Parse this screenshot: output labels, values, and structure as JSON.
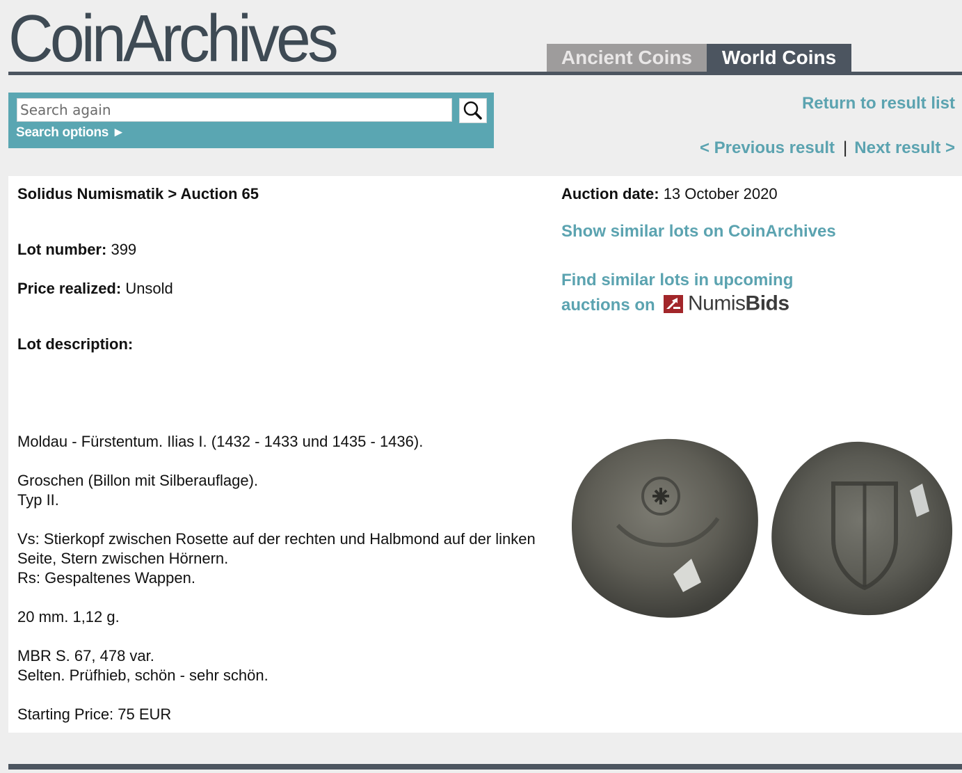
{
  "brand": {
    "logo_text": "CoinArchives"
  },
  "tabs": [
    {
      "label": "Ancient Coins"
    },
    {
      "label": "World Coins"
    }
  ],
  "search": {
    "placeholder": "Search again",
    "options_label": "Search options ►"
  },
  "navigation": {
    "return_label": "Return to result list",
    "previous_label": "< Previous result",
    "separator": "|",
    "next_label": "Next result >"
  },
  "lot": {
    "breadcrumb": "Solidus Numismatik > Auction 65",
    "lot_number_label": "Lot number:",
    "lot_number": "399",
    "price_label": "Price realized:",
    "price_value": "Unsold",
    "description_label": "Lot description:",
    "auction_date_label": "Auction date:",
    "auction_date": "13 October 2020"
  },
  "description": {
    "line1": "Moldau - Fürstentum. Ilias I. (1432 - 1433 und 1435 - 1436).",
    "line2": "Groschen (Billon mit Silberauflage).",
    "line3": "Typ II.",
    "line4": "Vs: Stierkopf zwischen Rosette auf der rechten und Halbmond auf der linken Seite, Stern zwischen Hörnern.",
    "line5": "Rs: Gespaltenes Wappen.",
    "line6": "20 mm. 1,12 g.",
    "line7": "MBR S. 67, 478 var.",
    "line8": "Selten. Prüfhieb, schön - sehr schön.",
    "line9": "Starting Price: 75 EUR"
  },
  "links": {
    "show_similar": "Show similar lots on CoinArchives",
    "upcoming_line1": "Find similar lots in upcoming",
    "upcoming_line2": "auctions on",
    "numisbids_part1": "Numis",
    "numisbids_part2": "Bids"
  },
  "colors": {
    "accent": "#5aa6b2",
    "link": "#5ba3b0",
    "dark_bar": "#4c5560",
    "tab_inactive": "#9e9c9c",
    "numisbids_red": "#a2262a"
  }
}
